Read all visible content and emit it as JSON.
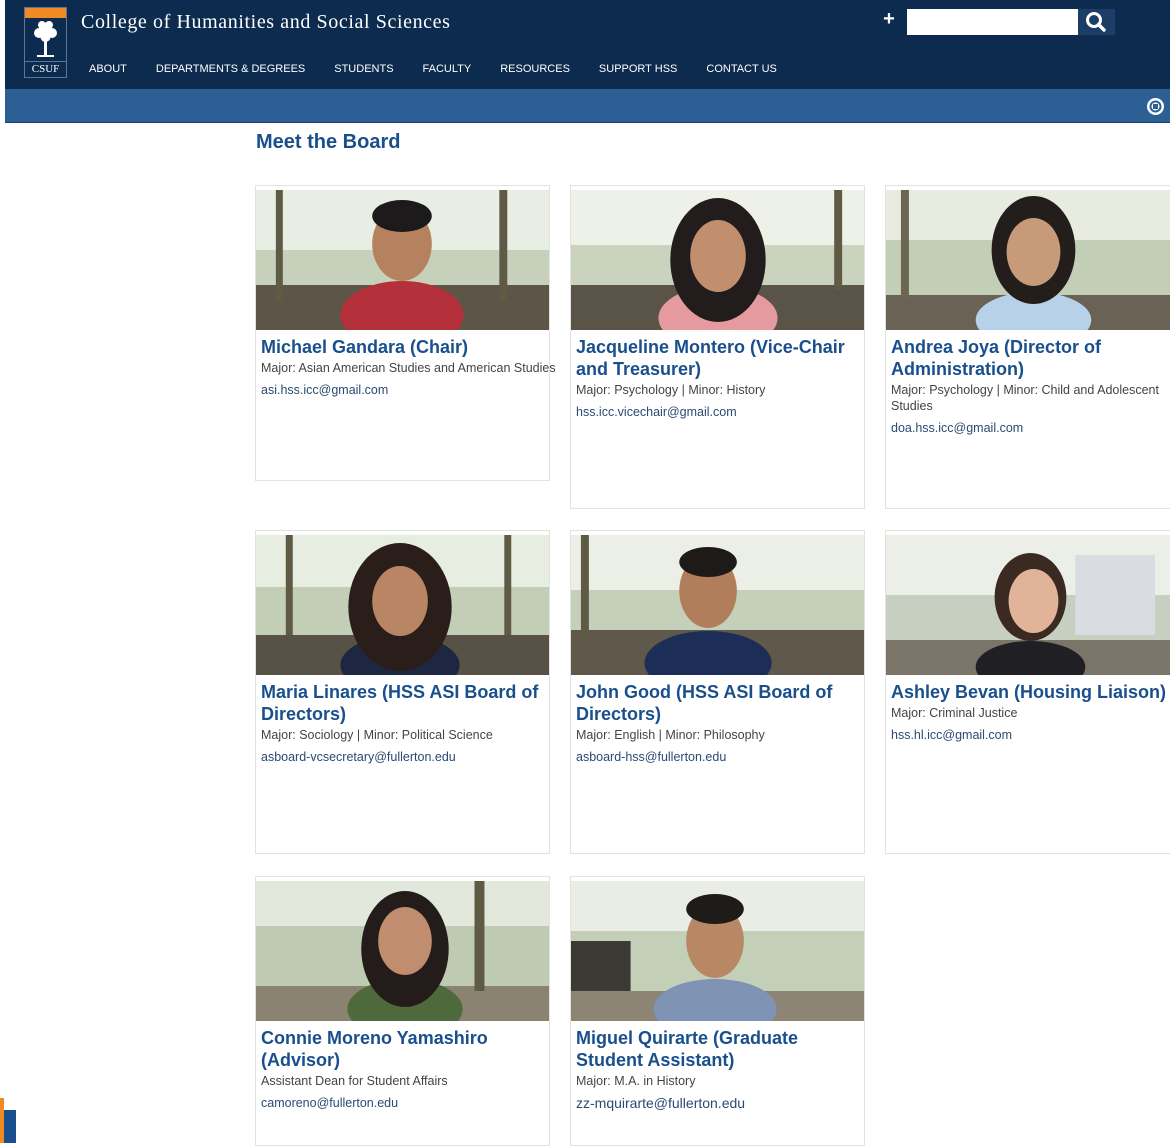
{
  "header": {
    "logo_text": "CSUF",
    "site_title": "College of Humanities and Social Sciences",
    "nav": [
      "ABOUT",
      "DEPARTMENTS & DEGREES",
      "STUDENTS",
      "FACULTY",
      "RESOURCES",
      "SUPPORT HSS",
      "CONTACT US"
    ],
    "search": {
      "value": "",
      "placeholder": ""
    },
    "icons": {
      "expand": "plus-icon",
      "search": "search-icon",
      "collapse": "collapse-icon"
    }
  },
  "main": {
    "title": "Meet the Board",
    "members": [
      {
        "name": "Michael Gandara (Chair)",
        "major": "Major: Asian American Studies and American Studies",
        "email": "asi.hss.icc@gmail.com"
      },
      {
        "name": "Jacqueline Montero (Vice-Chair and Treasurer)",
        "major": "Major: Psychology | Minor: History",
        "email": "hss.icc.vicechair@gmail.com"
      },
      {
        "name": "Andrea Joya (Director of Administration)",
        "major": "Major: Psychology | Minor: Child and Adolescent Studies",
        "email": "doa.hss.icc@gmail.com"
      },
      {
        "name": "Maria Linares (HSS ASI Board of Directors)",
        "major": "Major: Sociology | Minor: Political Science",
        "email": "asboard-vcsecretary@fullerton.edu"
      },
      {
        "name": "John Good (HSS ASI Board of Directors)",
        "major": "Major: English | Minor: Philosophy",
        "email": "asboard-hss@fullerton.edu"
      },
      {
        "name": "Ashley Bevan (Housing Liaison)",
        "major": "Major: Criminal Justice",
        "email": "hss.hl.icc@gmail.com"
      },
      {
        "name": "Connie Moreno Yamashiro (Advisor)",
        "major": "Assistant Dean for Student Affairs",
        "email": "camoreno@fullerton.edu"
      },
      {
        "name": "Miguel Quirarte (Graduate Student Assistant)",
        "major": "Major: M.A. in History",
        "email": "zz-mquirarte@fullerton.edu"
      }
    ]
  },
  "colors": {
    "header": "#0d2b4e",
    "subbar": "#2c5f94",
    "accent": "#f08a24",
    "link": "#1a4f8d"
  }
}
